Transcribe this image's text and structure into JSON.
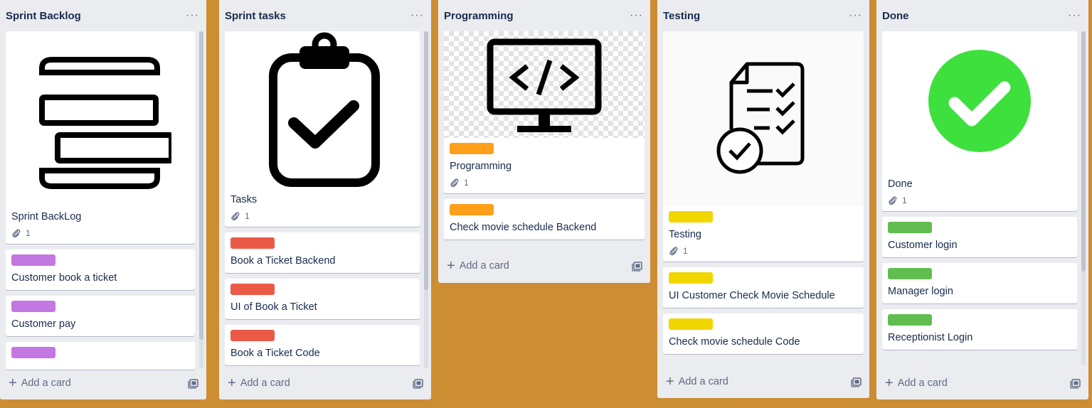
{
  "colors": {
    "board_bg": "#cd8d32",
    "label_purple": "#c377e0",
    "label_red": "#eb5a46",
    "label_orange": "#ff9f1a",
    "label_yellow": "#f2d600",
    "label_green": "#61bd4f",
    "done_circle": "#3ee03e"
  },
  "lists": [
    {
      "title": "Sprint Backlog",
      "menu": "···",
      "cover_icon": "stack-icon",
      "cover_title": "Sprint BackLog",
      "cover_attachments": "1",
      "cards": [
        {
          "title": "Customer book a ticket",
          "label_color": "purple"
        },
        {
          "title": "Customer pay",
          "label_color": "purple"
        },
        {
          "title": "",
          "label_color": "purple"
        }
      ],
      "add_card": "Add a card"
    },
    {
      "title": "Sprint tasks",
      "menu": "···",
      "cover_icon": "clipboard-check-icon",
      "cover_title": "Tasks",
      "cover_attachments": "1",
      "cards": [
        {
          "title": "Book a Ticket Backend",
          "label_color": "red"
        },
        {
          "title": "UI of Book a Ticket",
          "label_color": "red"
        },
        {
          "title": "Book a Ticket Code",
          "label_color": "red"
        }
      ],
      "add_card": "Add a card"
    },
    {
      "title": "Programming",
      "menu": "···",
      "cover_icon": "code-monitor-icon",
      "cover_title": "Programming",
      "cover_attachments": "1",
      "cards": [
        {
          "title": "Check movie schedule Backend",
          "label_color": "orange"
        }
      ],
      "add_card": "Add a card"
    },
    {
      "title": "Testing",
      "menu": "···",
      "cover_icon": "checklist-document-icon",
      "cover_title": "Testing",
      "cover_attachments": "1",
      "cards": [
        {
          "title": "UI Customer Check Movie Schedule",
          "label_color": "yellow"
        },
        {
          "title": "Check movie schedule Code",
          "label_color": "yellow"
        }
      ],
      "add_card": "Add a card"
    },
    {
      "title": "Done",
      "menu": "···",
      "cover_icon": "check-circle-icon",
      "cover_title": "Done",
      "cover_attachments": "1",
      "cards": [
        {
          "title": "Customer login",
          "label_color": "green"
        },
        {
          "title": "Manager login",
          "label_color": "green"
        },
        {
          "title": "Receptionist Login",
          "label_color": "green"
        }
      ],
      "add_card": "Add a card"
    }
  ]
}
